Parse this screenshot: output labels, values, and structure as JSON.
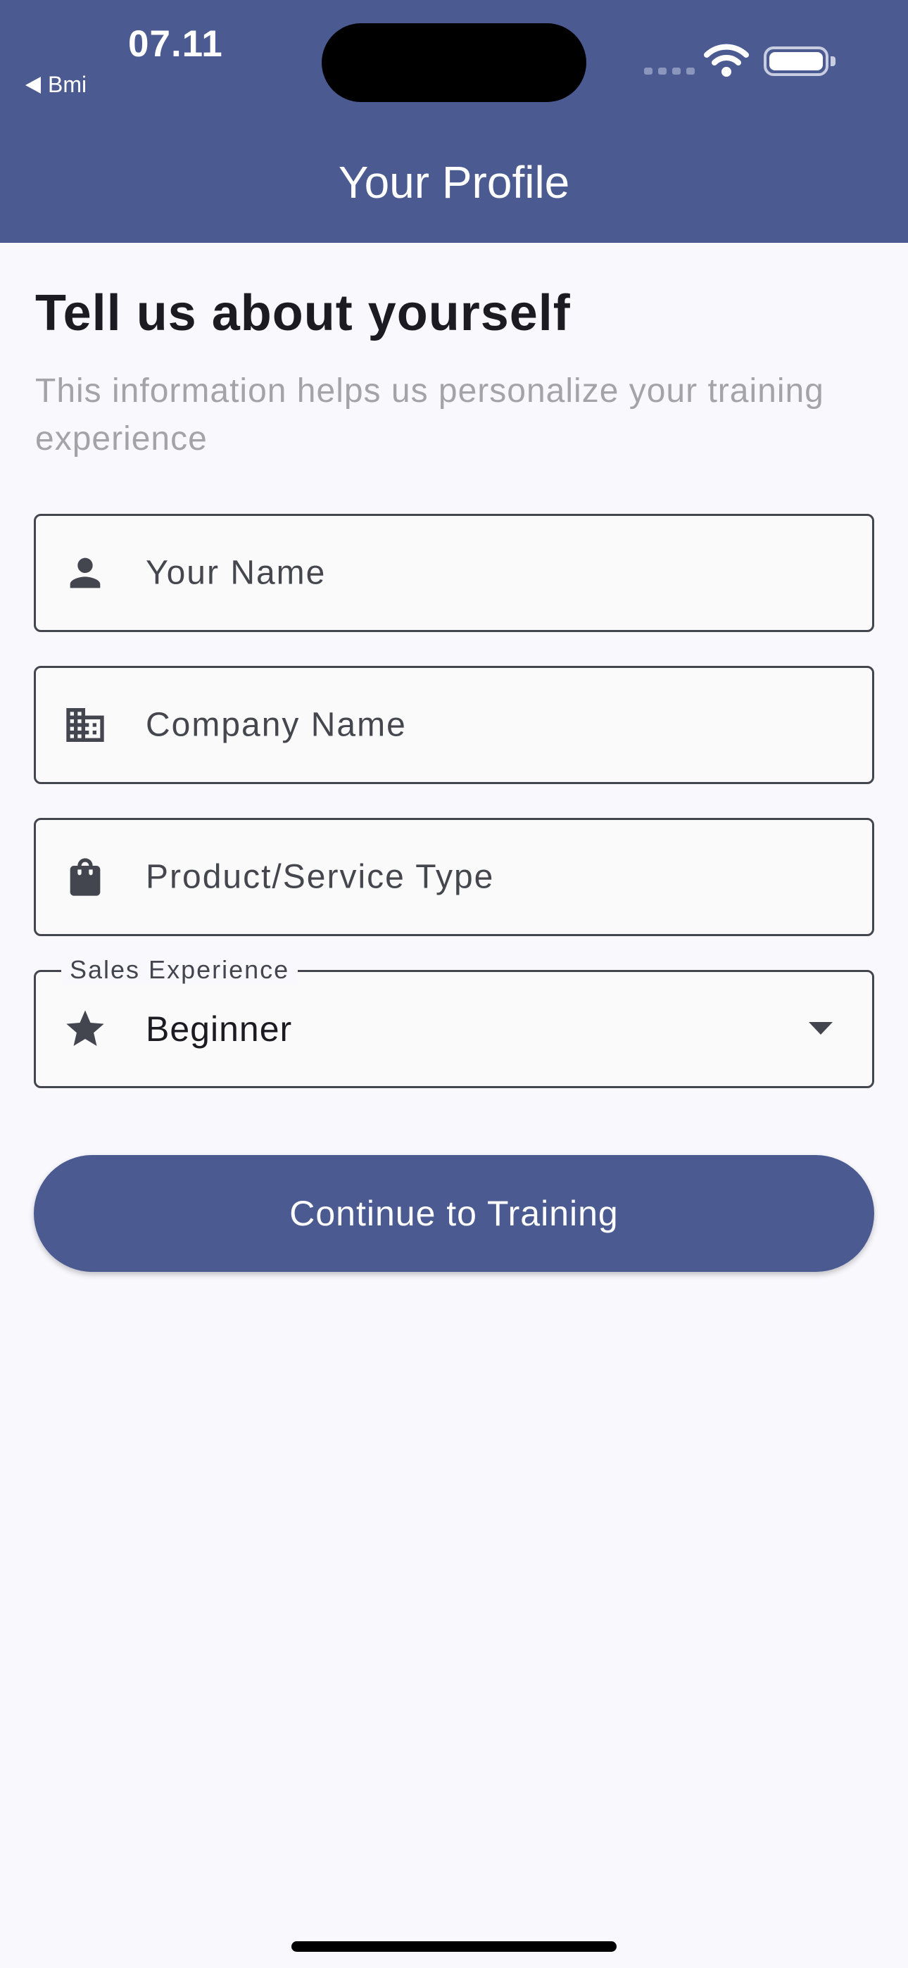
{
  "status_bar": {
    "time": "07.11",
    "back_label": "Bmi"
  },
  "app_bar": {
    "title": "Your Profile"
  },
  "intro": {
    "heading": "Tell us about yourself",
    "subtext": "This information helps us personalize your training experience"
  },
  "form": {
    "name_field": {
      "placeholder": "Your Name",
      "icon": "person-icon"
    },
    "company_field": {
      "placeholder": "Company Name",
      "icon": "business-icon"
    },
    "product_field": {
      "placeholder": "Product/Service Type",
      "icon": "shopping-bag-icon"
    },
    "experience_field": {
      "label": "Sales Experience",
      "value": "Beginner",
      "icon": "star-icon"
    }
  },
  "actions": {
    "continue_label": "Continue to Training"
  },
  "colors": {
    "primary": "#4b5b92",
    "background": "#f8f8fd",
    "outline": "#44464f",
    "heading_text": "#1b1b21",
    "secondary_text": "#a3a3a8"
  }
}
